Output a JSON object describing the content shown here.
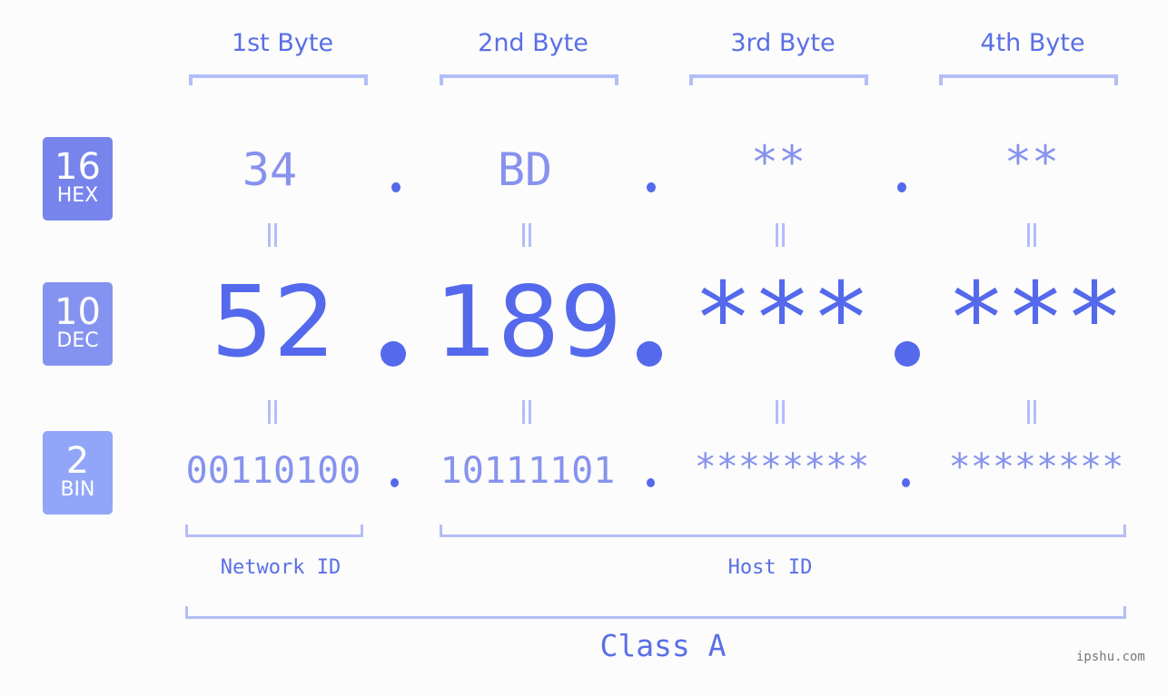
{
  "bytes": [
    {
      "header": "1st Byte",
      "hex": "34",
      "dec": "52",
      "bin": "00110100"
    },
    {
      "header": "2nd Byte",
      "hex": "BD",
      "dec": "189",
      "bin": "10111101"
    },
    {
      "header": "3rd Byte",
      "hex": "**",
      "dec": "***",
      "bin": "********"
    },
    {
      "header": "4th Byte",
      "hex": "**",
      "dec": "***",
      "bin": "********"
    }
  ],
  "badges": {
    "hex": {
      "num": "16",
      "label": "HEX",
      "color": "#7784ec"
    },
    "dec": {
      "num": "10",
      "label": "DEC",
      "color": "#8593f0"
    },
    "bin": {
      "num": "2",
      "label": "BIN",
      "color": "#91a6f8"
    }
  },
  "equals_sign": "=",
  "dot": ".",
  "network_id": "Network ID",
  "host_id": "Host ID",
  "ip_class": "Class A",
  "watermark": "ipshu.com",
  "colors": {
    "accent": "#5469ec",
    "light": "#8792ee",
    "bracket": "#b3bdf7"
  }
}
